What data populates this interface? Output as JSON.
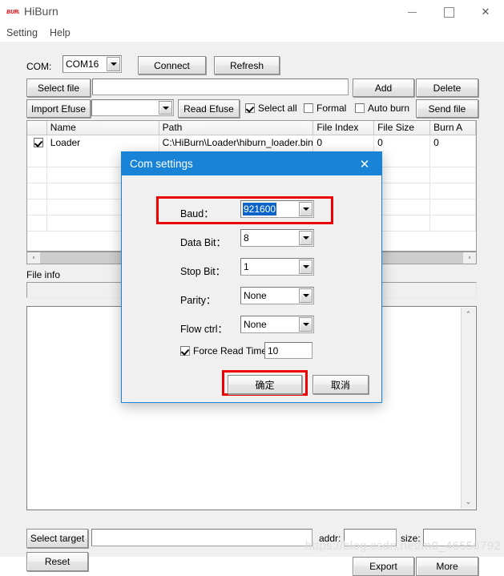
{
  "window": {
    "title": "HiBurn",
    "icon": "burn-logo-icon",
    "minimize": "—",
    "maximize": "□",
    "close": "✕"
  },
  "menu": {
    "items": [
      {
        "label": "Setting"
      },
      {
        "label": "Help"
      }
    ]
  },
  "toolbar": {
    "com_label": "COM:",
    "com_value": "COM16",
    "connect_label": "Connect",
    "refresh_label": "Refresh",
    "select_file_label": "Select file",
    "select_file_value": "",
    "add_label": "Add",
    "delete_label": "Delete",
    "import_efuse_label": "Import Efuse",
    "efuse_combo_value": "",
    "read_efuse_label": "Read Efuse",
    "select_all_label": "Select all",
    "select_all_checked": true,
    "formal_label": "Formal",
    "formal_checked": false,
    "auto_burn_label": "Auto burn",
    "auto_burn_checked": false,
    "send_file_label": "Send file"
  },
  "filelist": {
    "columns": [
      "",
      "Name",
      "Path",
      "File Index",
      "File Size",
      "Burn A"
    ],
    "rows": [
      {
        "checked": true,
        "name": "Loader",
        "path": "C:\\HiBurn\\Loader\\hiburn_loader.bin",
        "file_index": "0",
        "file_size": "0",
        "burn_addr": "0"
      }
    ],
    "hscroll_left": "‹",
    "hscroll_right": "›"
  },
  "fileinfo": {
    "label": "File info",
    "value": ""
  },
  "log": {
    "text": "",
    "scroll_up": "⌃",
    "scroll_down": "⌄"
  },
  "bottom": {
    "select_target_label": "Select target",
    "target_value": "",
    "addr_label": "addr:",
    "addr_value": "",
    "size_label": "size:",
    "size_value": "",
    "reset_label": "Reset",
    "export_label": "Export",
    "more_label": "More"
  },
  "watermark": "https://blog.csdn.net/m0_46556792",
  "dialog": {
    "title": "Com settings",
    "close": "✕",
    "fields": [
      {
        "label": "Baud：",
        "value": "921600",
        "selected": true
      },
      {
        "label": "Data Bit：",
        "value": "8",
        "selected": false
      },
      {
        "label": "Stop Bit：",
        "value": "1",
        "selected": false
      },
      {
        "label": "Parity：",
        "value": "None",
        "selected": false
      },
      {
        "label": "Flow ctrl：",
        "value": "None",
        "selected": false
      }
    ],
    "force_read_time_label": "Force Read Time",
    "force_read_time_checked": true,
    "force_read_time_value": "10",
    "ok_label": "确定",
    "cancel_label": "取消"
  },
  "colors": {
    "dialog_title_bg": "#1883d7",
    "highlight_red": "#ee0000",
    "selection_blue": "#0a64c8",
    "window_bg": "#f0f0f0"
  }
}
